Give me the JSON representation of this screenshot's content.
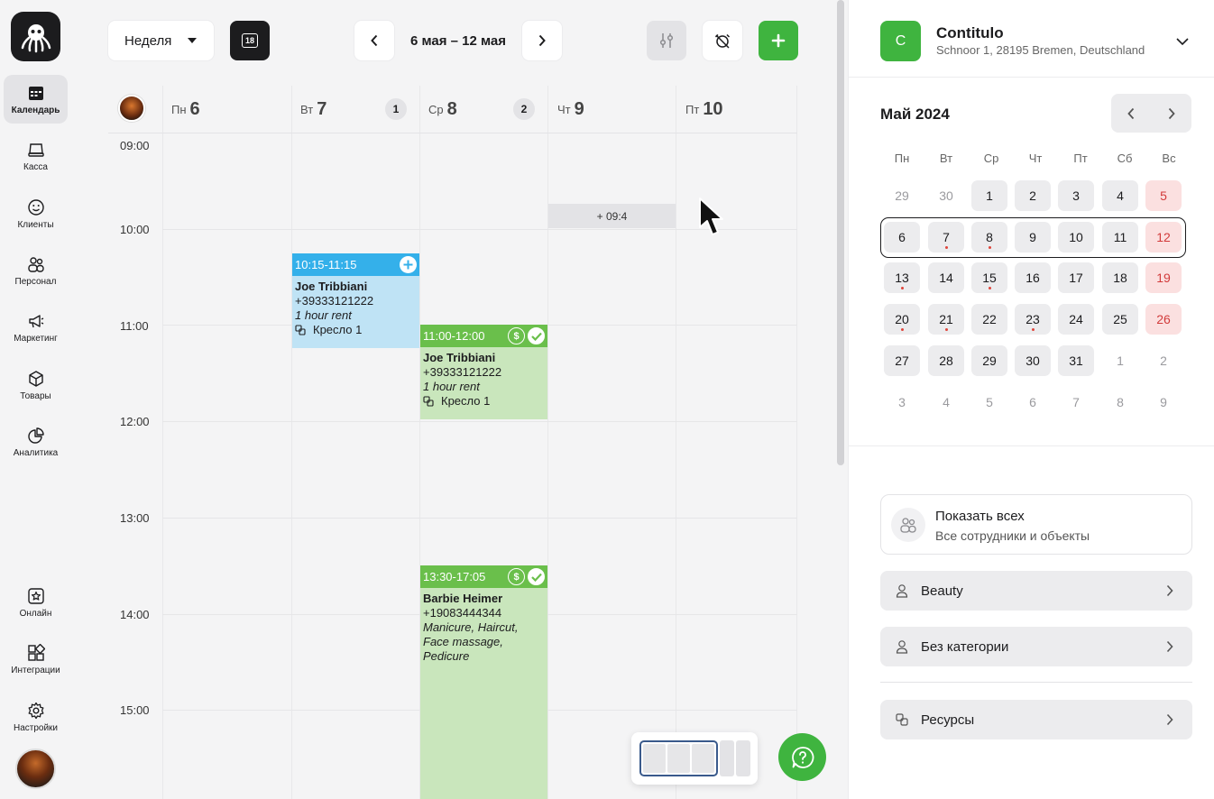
{
  "sidebar": {
    "items": [
      {
        "label": "Календарь",
        "icon": "calendar-icon"
      },
      {
        "label": "Касса",
        "icon": "register-icon"
      },
      {
        "label": "Клиенты",
        "icon": "smile-icon"
      },
      {
        "label": "Персонал",
        "icon": "staff-icon"
      },
      {
        "label": "Маркетинг",
        "icon": "megaphone-icon"
      },
      {
        "label": "Товары",
        "icon": "box-icon"
      },
      {
        "label": "Аналитика",
        "icon": "pie-chart-icon"
      },
      {
        "label": "Онлайн",
        "icon": "star-icon"
      },
      {
        "label": "Интеграции",
        "icon": "integrations-icon"
      },
      {
        "label": "Настройки",
        "icon": "gear-icon"
      }
    ]
  },
  "toolbar": {
    "view_select": "Неделя",
    "today_icon_number": "18",
    "date_range": "6 мая – 12 мая"
  },
  "calendar": {
    "days": [
      {
        "dow": "Пн",
        "num": "6",
        "badge": ""
      },
      {
        "dow": "Вт",
        "num": "7",
        "badge": "1"
      },
      {
        "dow": "Ср",
        "num": "8",
        "badge": "2"
      },
      {
        "dow": "Чт",
        "num": "9",
        "badge": ""
      },
      {
        "dow": "Пт",
        "num": "10",
        "badge": ""
      }
    ],
    "times": [
      "09:00",
      "10:00",
      "11:00",
      "12:00",
      "13:00",
      "14:00",
      "15:00"
    ],
    "hover_slot_label": "+ 09:4",
    "events": [
      {
        "time": "10:15-11:15",
        "name": "Joe Tribbiani",
        "phone": "+39333121222",
        "service": "1 hour rent",
        "resource": "Кресло 1"
      },
      {
        "time": "11:00-12:00",
        "name": "Joe Tribbiani",
        "phone": "+39333121222",
        "service": "1 hour rent",
        "resource": "Кресло 1"
      },
      {
        "time": "13:30-17:05",
        "name": "Barbie Heimer",
        "phone": "+19083444344",
        "service": "Manicure, Haircut, Face massage, Pedicure",
        "resource": ""
      }
    ]
  },
  "company": {
    "initial": "C",
    "name": "Contitulo",
    "address": "Schnoor 1, 28195 Bremen, Deutschland"
  },
  "mini_calendar": {
    "title": "Май 2024",
    "weekdays": [
      "Пн",
      "Вт",
      "Ср",
      "Чт",
      "Пт",
      "Сб",
      "Вс"
    ],
    "weeks": [
      [
        "29",
        "30",
        "1",
        "2",
        "3",
        "4",
        "5"
      ],
      [
        "6",
        "7",
        "8",
        "9",
        "10",
        "11",
        "12"
      ],
      [
        "13",
        "14",
        "15",
        "16",
        "17",
        "18",
        "19"
      ],
      [
        "20",
        "21",
        "22",
        "23",
        "24",
        "25",
        "26"
      ],
      [
        "27",
        "28",
        "29",
        "30",
        "31",
        "1",
        "2"
      ],
      [
        "3",
        "4",
        "5",
        "6",
        "7",
        "8",
        "9"
      ]
    ]
  },
  "filters": {
    "show_all_title": "Показать всех",
    "show_all_sub": "Все сотрудники и объекты",
    "categories": [
      "Beauty",
      "Без категории"
    ],
    "resources": "Ресурсы"
  },
  "colors": {
    "accent_green": "#3fb43f",
    "event_blue": "#34b0ea",
    "event_green": "#6abf4b",
    "weekend_red": "#d23b3b"
  }
}
